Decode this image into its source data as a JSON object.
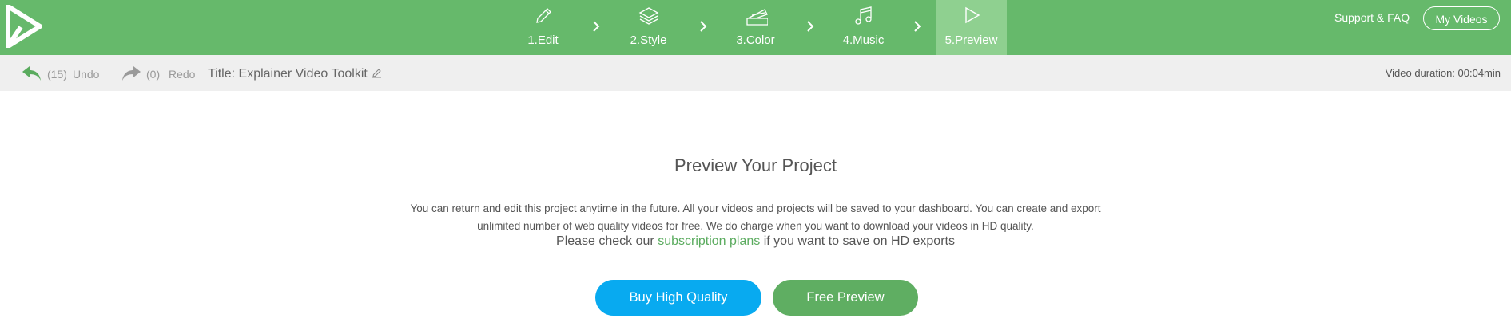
{
  "colors": {
    "brand_green": "#66b96b",
    "active_step": "#8fd090",
    "blue": "#08aaf0",
    "link_green": "#5aab5e"
  },
  "header": {
    "steps": [
      {
        "label": "1.Edit",
        "icon": "pencil-icon"
      },
      {
        "label": "2.Style",
        "icon": "layers-icon"
      },
      {
        "label": "3.Color",
        "icon": "swatch-icon"
      },
      {
        "label": "4.Music",
        "icon": "music-note-icon"
      },
      {
        "label": "5.Preview",
        "icon": "play-icon",
        "active": true
      }
    ],
    "support_label": "Support & FAQ",
    "my_videos_label": "My Videos"
  },
  "toolbar": {
    "undo_count": "(15)",
    "undo_label": "Undo",
    "redo_count": "(0)",
    "redo_label": "Redo",
    "title": "Title: Explainer Video Toolkit",
    "duration": "Video duration: 00:04min"
  },
  "main": {
    "heading": "Preview Your Project",
    "paragraph": "You can return and edit this project anytime in the future. All your videos and projects will be saved to your dashboard. You can create and export unlimited number of web quality videos for free. We do charge when you want to download your videos in HD quality.",
    "check_prefix": "Please check our",
    "check_link": "subscription plans",
    "check_suffix": "if you want to save on HD exports",
    "buy_button": "Buy High Quality",
    "free_button": "Free Preview"
  }
}
